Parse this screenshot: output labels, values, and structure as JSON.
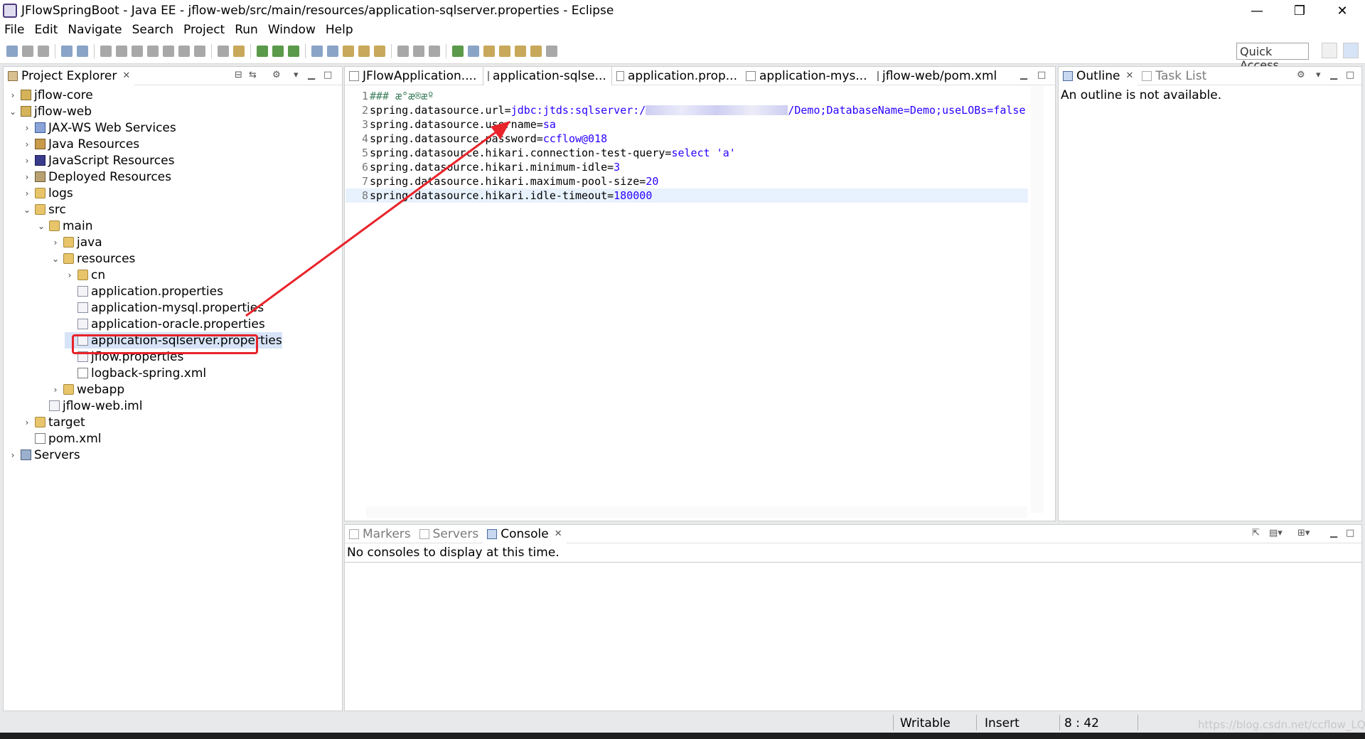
{
  "window": {
    "title": "JFlowSpringBoot - Java EE - jflow-web/src/main/resources/application-sqlserver.properties - Eclipse",
    "controls": [
      "—",
      "❐",
      "✕"
    ]
  },
  "menu": [
    "File",
    "Edit",
    "Navigate",
    "Search",
    "Project",
    "Run",
    "Window",
    "Help"
  ],
  "toolbar": {
    "quick_access": "Quick Access"
  },
  "project_explorer": {
    "tab_label": "Project Explorer",
    "items": [
      {
        "label": "jflow-core",
        "twisty": "›",
        "icon": "project-icon"
      },
      {
        "label": "jflow-web",
        "twisty": "⌄",
        "icon": "project-icon"
      },
      {
        "label": "JAX-WS Web Services",
        "twisty": "›",
        "icon": "web-services-icon"
      },
      {
        "label": "Java Resources",
        "twisty": "›",
        "icon": "java-resources-icon"
      },
      {
        "label": "JavaScript Resources",
        "twisty": "›",
        "icon": "javascript-resources-icon"
      },
      {
        "label": "Deployed Resources",
        "twisty": "›",
        "icon": "deployed-resources-icon"
      },
      {
        "label": "logs",
        "twisty": "›",
        "icon": "folder-icon"
      },
      {
        "label": "src",
        "twisty": "⌄",
        "icon": "folder-icon"
      },
      {
        "label": "main",
        "twisty": "⌄",
        "icon": "folder-icon"
      },
      {
        "label": "java",
        "twisty": "›",
        "icon": "folder-icon"
      },
      {
        "label": "resources",
        "twisty": "⌄",
        "icon": "folder-icon"
      },
      {
        "label": "cn",
        "twisty": "›",
        "icon": "folder-icon"
      },
      {
        "label": "application.properties",
        "twisty": "",
        "icon": "properties-file-icon"
      },
      {
        "label": "application-mysql.properties",
        "twisty": "",
        "icon": "properties-file-icon"
      },
      {
        "label": "application-oracle.properties",
        "twisty": "",
        "icon": "properties-file-icon"
      },
      {
        "label": "application-sqlserver.properties",
        "twisty": "",
        "icon": "properties-file-icon"
      },
      {
        "label": "jflow.properties",
        "twisty": "",
        "icon": "properties-file-icon"
      },
      {
        "label": "logback-spring.xml",
        "twisty": "",
        "icon": "xml-file-icon"
      },
      {
        "label": "webapp",
        "twisty": "›",
        "icon": "folder-icon"
      },
      {
        "label": "jflow-web.iml",
        "twisty": "",
        "icon": "file-icon"
      },
      {
        "label": "target",
        "twisty": "›",
        "icon": "folder-icon"
      },
      {
        "label": "pom.xml",
        "twisty": "",
        "icon": "xml-file-icon"
      },
      {
        "label": "Servers",
        "twisty": "›",
        "icon": "servers-icon"
      }
    ]
  },
  "editor": {
    "tabs": [
      {
        "label": "JFlowApplication...."
      },
      {
        "label": "application-sqlse..."
      },
      {
        "label": "application.prop..."
      },
      {
        "label": "application-mys..."
      },
      {
        "label": "jflow-web/pom.xml"
      }
    ],
    "lines": [
      {
        "num": "1",
        "key": "### æ°æ®æº",
        "val": ""
      },
      {
        "num": "2",
        "key": "spring.datasource.url=",
        "val": "jdbc:jtds:sqlserver:/",
        "val2": "/Demo;DatabaseName=Demo;useLOBs=false"
      },
      {
        "num": "3",
        "key": "spring.datasource.username=",
        "val": "sa"
      },
      {
        "num": "4",
        "key": "spring.datasource.password=",
        "val": "ccflow@018"
      },
      {
        "num": "5",
        "key": "spring.datasource.hikari.connection-test-query=",
        "val": "select 'a'"
      },
      {
        "num": "6",
        "key": "spring.datasource.hikari.minimum-idle=",
        "val": "3"
      },
      {
        "num": "7",
        "key": "spring.datasource.hikari.maximum-pool-size=",
        "val": "20"
      },
      {
        "num": "8",
        "key": "spring.datasource.hikari.idle-timeout=",
        "val": "180000"
      }
    ]
  },
  "outline": {
    "tabs": [
      {
        "label": "Outline"
      },
      {
        "label": "Task List"
      }
    ],
    "message": "An outline is not available."
  },
  "console": {
    "tabs": [
      {
        "label": "Markers"
      },
      {
        "label": "Servers"
      },
      {
        "label": "Console"
      }
    ],
    "message": "No consoles to display at this time."
  },
  "status_bar": {
    "writable": "Writable",
    "insert": "Insert",
    "position": "8 : 42"
  },
  "watermark": "https://blog.csdn.net/ccflow_LQ",
  "colors": {
    "annotation": "#e8232a",
    "value_text": "#2a00ff"
  }
}
